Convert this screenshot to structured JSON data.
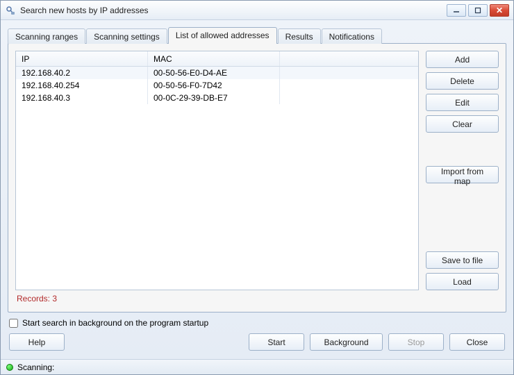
{
  "window": {
    "title": "Search new hosts by IP addresses"
  },
  "tabs": {
    "t0": "Scanning ranges",
    "t1": "Scanning settings",
    "t2": "List of allowed addresses",
    "t3": "Results",
    "t4": "Notifications"
  },
  "table": {
    "headers": {
      "ip": "IP",
      "mac": "MAC"
    },
    "rows": [
      {
        "ip": "192.168.40.2",
        "mac": "00-50-56-E0-D4-AE"
      },
      {
        "ip": "192.168.40.254",
        "mac": "00-50-56-F0-7D42"
      },
      {
        "ip": "192.168.40.3",
        "mac": "00-0C-29-39-DB-E7"
      }
    ],
    "records_label": "Records: 3"
  },
  "side": {
    "add": "Add",
    "delete": "Delete",
    "edit": "Edit",
    "clear": "Clear",
    "import": "Import from map",
    "save": "Save to file",
    "load": "Load"
  },
  "options": {
    "bg_startup": "Start search in background on the program startup"
  },
  "footer": {
    "help": "Help",
    "start": "Start",
    "background": "Background",
    "stop": "Stop",
    "close": "Close"
  },
  "status": {
    "text": "Scanning:"
  }
}
